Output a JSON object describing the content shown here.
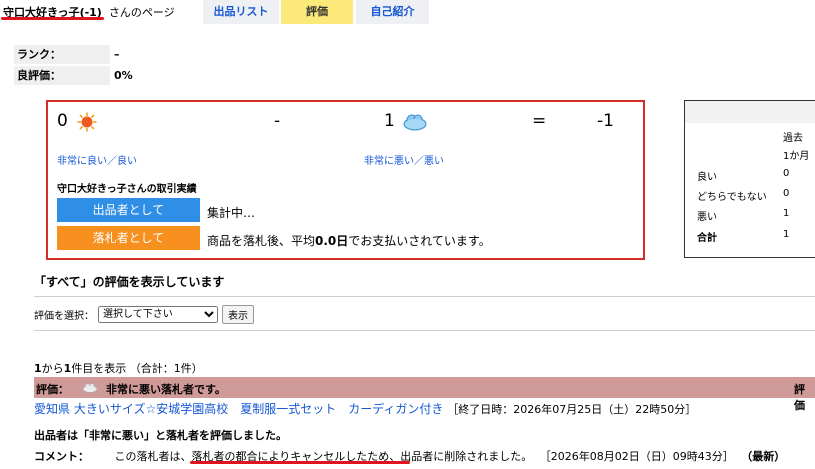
{
  "header": {
    "seller_name": "守口大好きっ子",
    "seller_score": "(-1)",
    "page_suffix": "さんのページ",
    "tabs": [
      {
        "label": "出品リスト",
        "active": false
      },
      {
        "label": "評価",
        "active": true
      },
      {
        "label": "自己紹介",
        "active": false
      }
    ]
  },
  "rank": {
    "rank_label": "ランク：",
    "rank_value": "–",
    "good_label": "良評価：",
    "good_value": "0%"
  },
  "summary": {
    "good_count": "0",
    "minus": "-",
    "bad_count": "1",
    "equals": "=",
    "total": "-1",
    "good_link": "非常に良い／良い",
    "bad_link": "非常に悪い／悪い",
    "record_title": "守口大好きっ子さんの取引実績",
    "seller_role_label": "出品者として",
    "seller_role_text": "集計中…",
    "buyer_role_label": "落札者として",
    "buyer_role_text_pre": "商品を落札後、平均",
    "buyer_role_days": "0.0日",
    "buyer_role_text_post": "でお支払いされています。",
    "seller_color": "#2f8fe6",
    "buyer_color": "#f7901e"
  },
  "side_table": {
    "col_header_1": "過去",
    "col_header_2": "1か月",
    "rows": [
      {
        "label": "良い",
        "value": "0",
        "bold": false
      },
      {
        "label": "どちらでもない",
        "value": "0",
        "bold": false
      },
      {
        "label": "悪い",
        "value": "1",
        "bold": false
      },
      {
        "label": "合計",
        "value": "1",
        "bold": true
      }
    ]
  },
  "filter": {
    "heading": "「すべて」の評価を表示しています",
    "select_label": "評価を選択：",
    "select_value": "選択して下さい",
    "show_button": "表示"
  },
  "results": {
    "count_pre": "1",
    "count_mid": "から",
    "count_mid2": "1",
    "count_post": "件目を表示 （合計：1件）"
  },
  "review": {
    "bar_label": "評価：",
    "bar_text": "非常に悪い落札者です。",
    "bar_right": "評価",
    "item_title": "愛知県 大きいサイズ☆安城学園高校　夏制服一式セット　カーディガン付き",
    "end_date": "［終了日時：2026年07月25日（土）22時50分］",
    "verdict": "出品者は「非常に悪い」と落札者を評価しました。",
    "comment_label": "コメント：",
    "comment_pre": "この落札者は、",
    "comment_highlight": "落札者の都合によりキャンセルしたため",
    "comment_post": "、出品者に削除されました。",
    "comment_date": "［2026年08月02日（日）09時43分］",
    "latest": "（最新）",
    "bar_color": "#cf9a97"
  }
}
